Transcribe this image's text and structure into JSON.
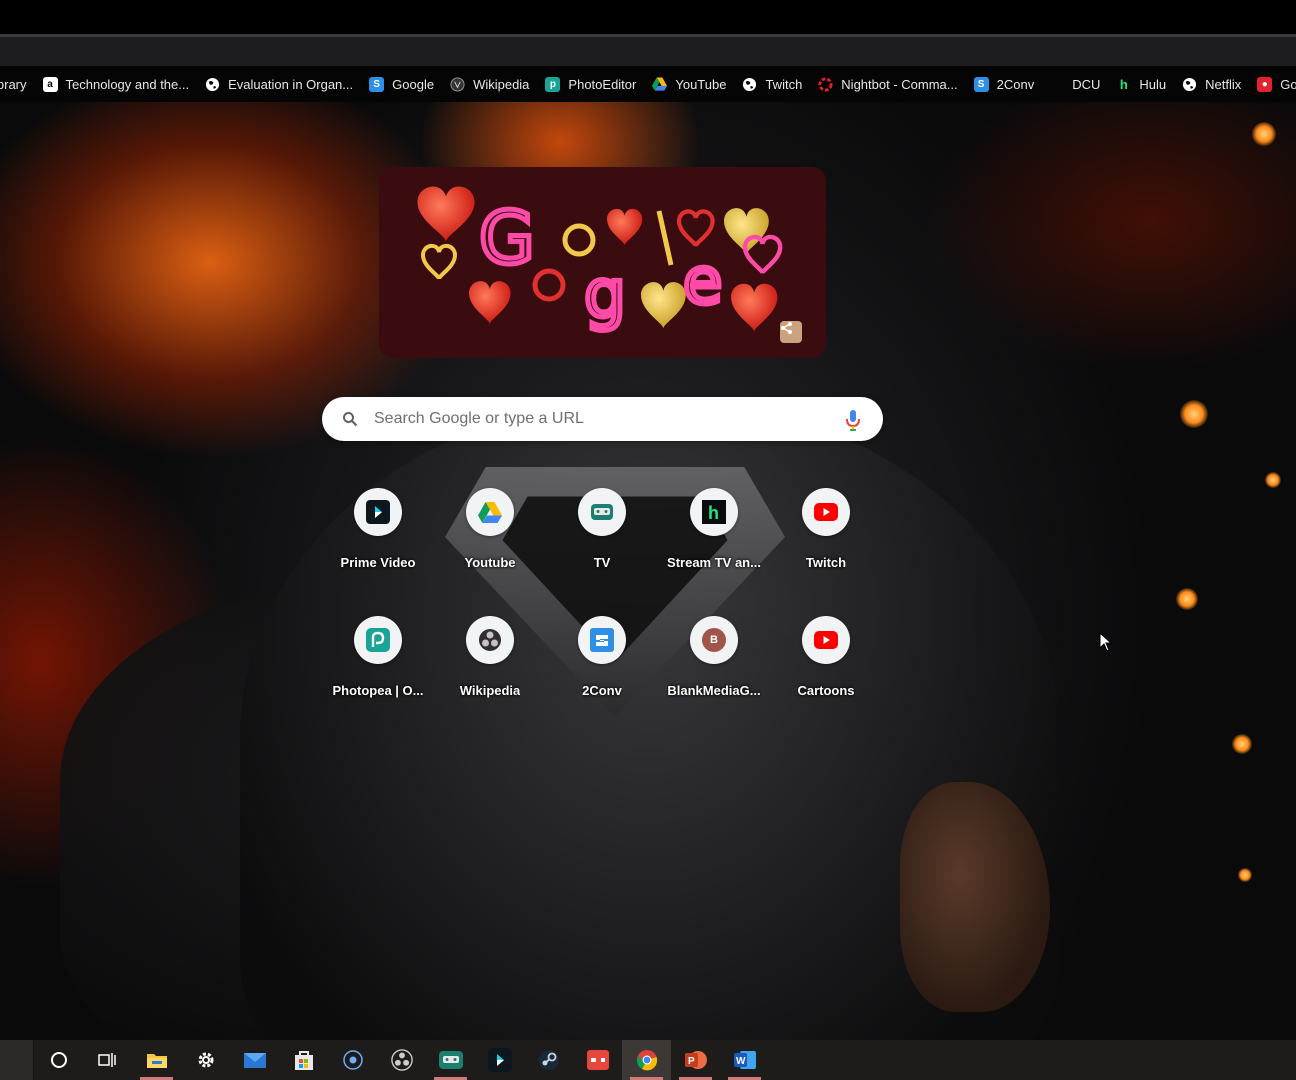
{
  "bookmarks": [
    {
      "label": "ibrary",
      "icon": "none"
    },
    {
      "label": "Technology and the...",
      "icon": "amazon-icon"
    },
    {
      "label": "Evaluation in Organ...",
      "icon": "globe-icon"
    },
    {
      "label": "Google",
      "icon": "2conv-icon"
    },
    {
      "label": "Wikipedia",
      "icon": "wikipedia-icon"
    },
    {
      "label": "PhotoEditor",
      "icon": "photopea-icon"
    },
    {
      "label": "YouTube",
      "icon": "drive-icon"
    },
    {
      "label": "Twitch",
      "icon": "globe-icon"
    },
    {
      "label": "Nightbot - Comma...",
      "icon": "nightbot-icon"
    },
    {
      "label": "2Conv",
      "icon": "2conv-icon"
    },
    {
      "label": "DCU",
      "icon": "none"
    },
    {
      "label": "Hulu",
      "icon": "hulu-icon"
    },
    {
      "label": "Netflix",
      "icon": "globe-icon"
    },
    {
      "label": "GoStream",
      "icon": "gostream-icon"
    }
  ],
  "search": {
    "placeholder": "Search Google or type a URL"
  },
  "shortcuts": [
    {
      "title": "Prime Video",
      "icon": "prime-video-icon"
    },
    {
      "title": "Youtube",
      "icon": "drive-icon"
    },
    {
      "title": "TV",
      "icon": "tv-bot-icon"
    },
    {
      "title": "Stream TV an...",
      "icon": "hulu-icon"
    },
    {
      "title": "Twitch",
      "icon": "youtube-icon"
    },
    {
      "title": "Photopea | O...",
      "icon": "photopea-icon"
    },
    {
      "title": "Wikipedia",
      "icon": "wikipedia-icon"
    },
    {
      "title": "2Conv",
      "icon": "2conv-icon"
    },
    {
      "title": "BlankMediaG...",
      "icon": "letter-avatar-icon",
      "letter": "B"
    },
    {
      "title": "Cartoons",
      "icon": "youtube-icon"
    }
  ],
  "taskbar": [
    {
      "name": "cortana-search",
      "icon": "circle-icon"
    },
    {
      "name": "task-view",
      "icon": "task-view-icon"
    },
    {
      "name": "file-explorer",
      "icon": "folder-icon"
    },
    {
      "name": "settings",
      "icon": "gear-icon"
    },
    {
      "name": "mail",
      "icon": "mail-icon"
    },
    {
      "name": "store",
      "icon": "store-icon"
    },
    {
      "name": "cortana",
      "icon": "ring-icon"
    },
    {
      "name": "obs",
      "icon": "obs-icon"
    },
    {
      "name": "tv-app",
      "icon": "tv-bot-icon"
    },
    {
      "name": "prime-video",
      "icon": "prime-video-icon"
    },
    {
      "name": "steam",
      "icon": "steam-icon"
    },
    {
      "name": "game-app",
      "icon": "gamepad-icon"
    },
    {
      "name": "chrome",
      "icon": "chrome-icon"
    },
    {
      "name": "powerpoint",
      "icon": "powerpoint-icon"
    },
    {
      "name": "word",
      "icon": "word-icon"
    }
  ],
  "colors": {
    "accent_red": "#ff0000",
    "taskbar_bg": "#1e1c1b",
    "doodle_bg": "#3a0c10"
  }
}
